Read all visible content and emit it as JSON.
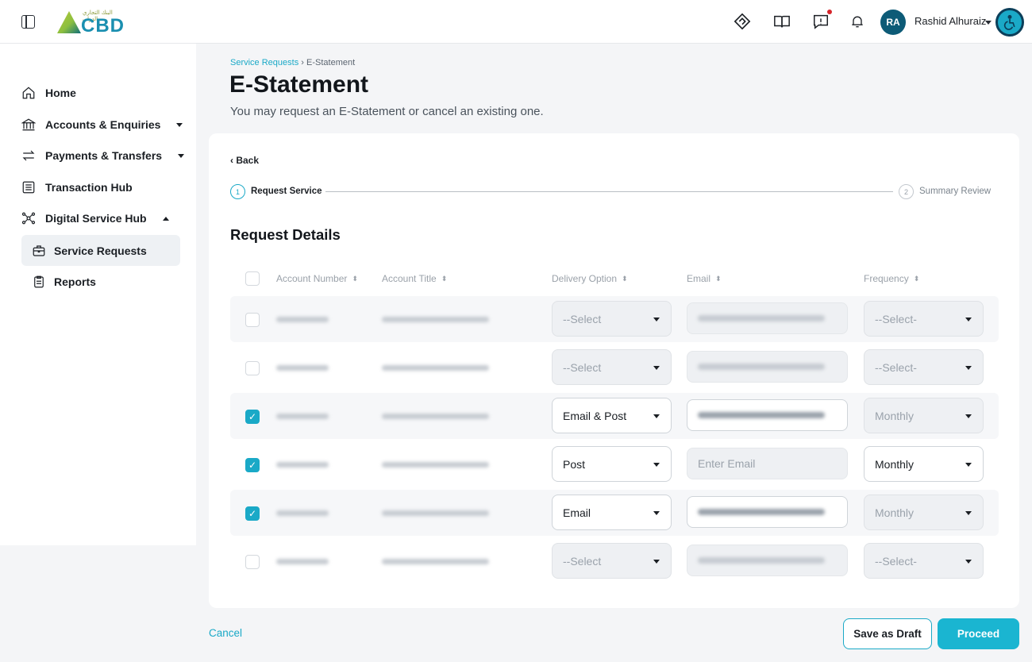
{
  "header": {
    "logo_text": "CBD",
    "logo_arabic": "البنك التجاري الدولي",
    "user_initials": "RA",
    "user_name": "Rashid Alhuraiz",
    "icons": [
      "handshake-icon",
      "book-icon",
      "feedback-icon",
      "bell-icon",
      "accessibility-icon"
    ]
  },
  "sidebar": {
    "items": [
      {
        "label": "Home",
        "icon": "home-icon"
      },
      {
        "label": "Accounts & Enquiries",
        "icon": "bank-icon"
      },
      {
        "label": "Payments & Transfers",
        "icon": "transfer-icon"
      },
      {
        "label": "Transaction Hub",
        "icon": "list-icon"
      },
      {
        "label": "Digital Service Hub",
        "icon": "network-icon"
      }
    ],
    "sub_items": [
      {
        "label": "Service Requests",
        "icon": "briefcase-icon",
        "active": true
      },
      {
        "label": "Reports",
        "icon": "clipboard-icon"
      }
    ]
  },
  "breadcrumb": {
    "parent": "Service Requests",
    "separator": "›",
    "current": "E-Statement"
  },
  "page": {
    "title": "E-Statement",
    "subtitle": "You may request an E-Statement or cancel an existing one."
  },
  "card": {
    "back_label": "‹ Back",
    "steps": [
      {
        "number": "1",
        "label": "Request Service"
      },
      {
        "number": "2",
        "label": "Summary Review"
      }
    ],
    "section_title": "Request Details",
    "columns": [
      "Account Number",
      "Account Title",
      "Delivery Option",
      "Email",
      "Frequency"
    ],
    "rows": [
      {
        "checked": false,
        "delivery": "--Select",
        "email": "",
        "email_placeholder": "",
        "frequency": "--Select-",
        "delivery_active": false,
        "frequency_active": false,
        "email_active": false
      },
      {
        "checked": false,
        "delivery": "--Select",
        "email": "",
        "email_placeholder": "",
        "frequency": "--Select-",
        "delivery_active": false,
        "frequency_active": false,
        "email_active": false
      },
      {
        "checked": true,
        "delivery": "Email & Post",
        "email": "",
        "email_placeholder": "",
        "frequency": "Monthly",
        "delivery_active": true,
        "frequency_active": false,
        "email_active": true
      },
      {
        "checked": true,
        "delivery": "Post",
        "email": "",
        "email_placeholder": "Enter Email",
        "frequency": "Monthly",
        "delivery_active": true,
        "frequency_active": true,
        "email_active": false
      },
      {
        "checked": true,
        "delivery": "Email",
        "email": "",
        "email_placeholder": "",
        "frequency": "Monthly",
        "delivery_active": true,
        "frequency_active": false,
        "email_active": true
      },
      {
        "checked": false,
        "delivery": "--Select",
        "email": "",
        "email_placeholder": "",
        "frequency": "--Select-",
        "delivery_active": false,
        "frequency_active": false,
        "email_active": false
      }
    ]
  },
  "footer": {
    "cancel_label": "Cancel",
    "draft_label": "Save as Draft",
    "proceed_label": "Proceed"
  },
  "colors": {
    "accent": "#1aa9c7",
    "avatar": "#0d5b77",
    "notification": "#d6252b"
  }
}
